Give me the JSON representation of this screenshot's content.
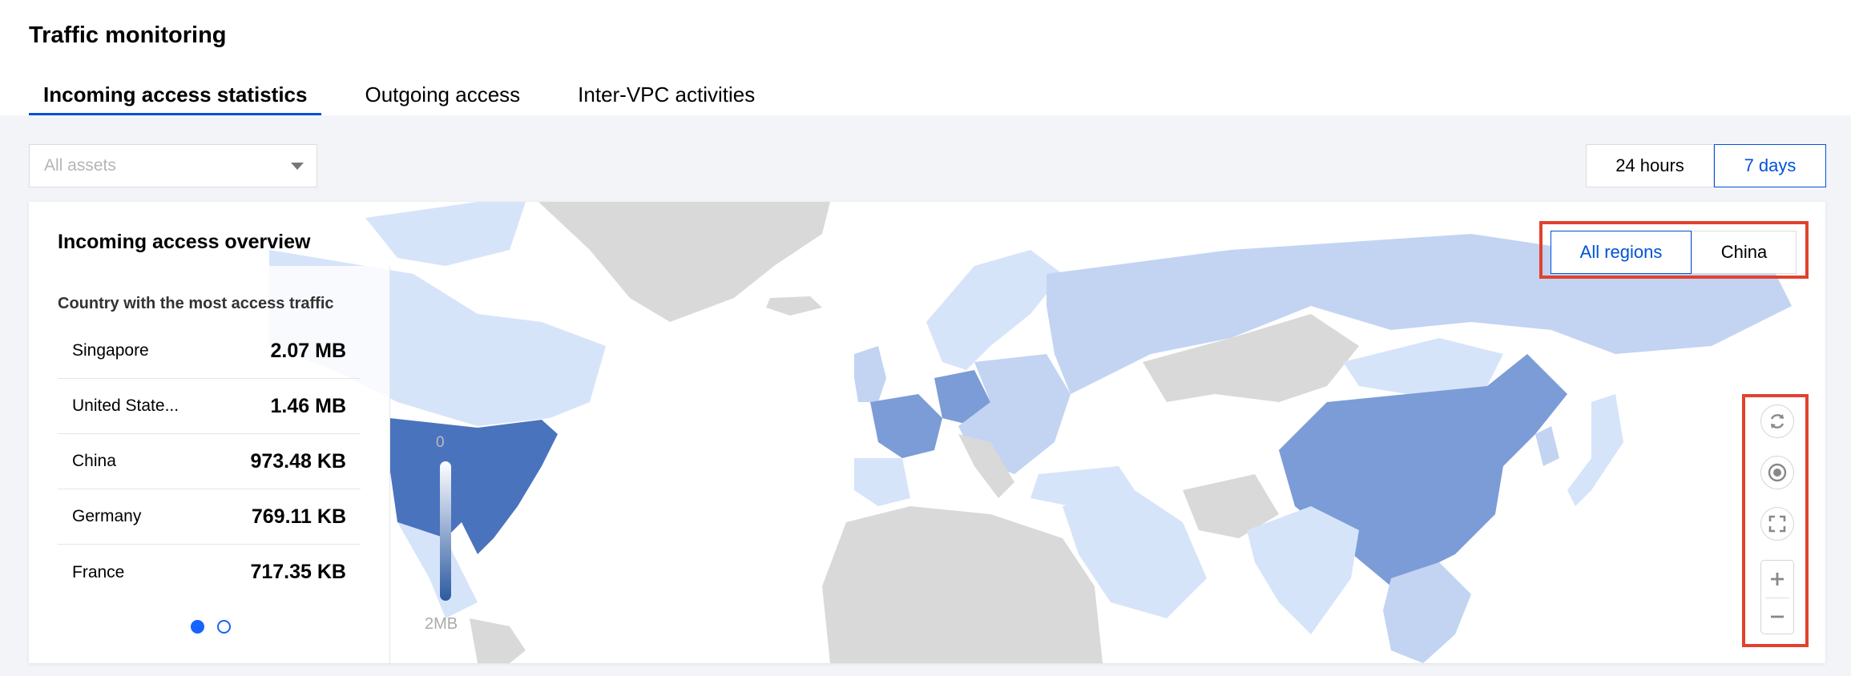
{
  "page_title": "Traffic monitoring",
  "tabs": [
    {
      "label": "Incoming access statistics",
      "active": true
    },
    {
      "label": "Outgoing access",
      "active": false
    },
    {
      "label": "Inter-VPC activities",
      "active": false
    }
  ],
  "asset_filter": {
    "placeholder": "All assets"
  },
  "time_range": {
    "options": [
      "24 hours",
      "7 days"
    ],
    "selected": "7 days"
  },
  "overview": {
    "title": "Incoming access overview",
    "list_heading": "Country with the most access traffic",
    "countries": [
      {
        "name": "Singapore",
        "value": "2.07 MB"
      },
      {
        "name": "United State...",
        "value": "1.46 MB"
      },
      {
        "name": "China",
        "value": "973.48 KB"
      },
      {
        "name": "Germany",
        "value": "769.11 KB"
      },
      {
        "name": "France",
        "value": "717.35 KB"
      }
    ],
    "page_count": 2,
    "current_page": 1
  },
  "legend": {
    "min_label": "0",
    "max_label": "2MB",
    "color_low": "#ffffff",
    "color_high": "#2c5aa0"
  },
  "region": {
    "options": [
      "All regions",
      "China"
    ],
    "selected": "All regions"
  },
  "map_controls": [
    "refresh-icon",
    "locate-icon",
    "fullscreen-icon",
    "zoom-in-icon",
    "zoom-out-icon"
  ],
  "colors": {
    "accent": "#0052d9",
    "highlight_border": "#e0422f",
    "map_no_data": "#d9d9d9",
    "map_low": "#d6e4fa",
    "map_mid": "#c2d4f2",
    "map_high": "#7b9cd6",
    "map_max": "#4a73be"
  }
}
